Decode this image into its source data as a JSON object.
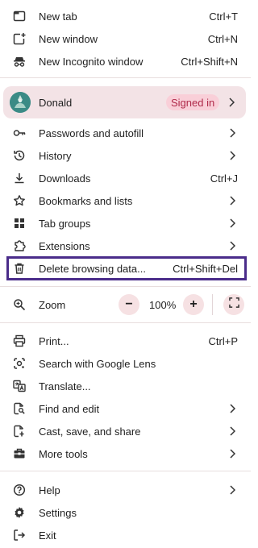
{
  "menu": {
    "new_tab": {
      "label": "New tab",
      "shortcut": "Ctrl+T",
      "icon": "new-tab-icon"
    },
    "new_window": {
      "label": "New window",
      "shortcut": "Ctrl+N",
      "icon": "new-window-icon"
    },
    "new_incognito": {
      "label": "New Incognito window",
      "shortcut": "Ctrl+Shift+N",
      "icon": "incognito-icon"
    },
    "profile": {
      "name": "Donald",
      "status": "Signed in",
      "accent": "#b02a4a",
      "bg": "#f3e3e6"
    },
    "passwords": {
      "label": "Passwords and autofill",
      "icon": "key-icon"
    },
    "history": {
      "label": "History",
      "icon": "history-icon"
    },
    "downloads": {
      "label": "Downloads",
      "shortcut": "Ctrl+J",
      "icon": "download-icon"
    },
    "bookmarks": {
      "label": "Bookmarks and lists",
      "icon": "star-icon"
    },
    "tab_groups": {
      "label": "Tab groups",
      "icon": "tab-groups-icon"
    },
    "extensions": {
      "label": "Extensions",
      "icon": "puzzle-icon"
    },
    "delete_data": {
      "label": "Delete browsing data...",
      "shortcut": "Ctrl+Shift+Del",
      "icon": "trash-icon",
      "highlight_color": "#4a2c8a"
    },
    "zoom": {
      "label": "Zoom",
      "minus": "−",
      "value": "100%",
      "plus": "+",
      "icon": "zoom-icon"
    },
    "print": {
      "label": "Print...",
      "shortcut": "Ctrl+P",
      "icon": "print-icon"
    },
    "google_lens": {
      "label": "Search with Google Lens",
      "icon": "lens-icon"
    },
    "translate": {
      "label": "Translate...",
      "icon": "translate-icon"
    },
    "find_edit": {
      "label": "Find and edit",
      "icon": "find-icon"
    },
    "cast_save_share": {
      "label": "Cast, save, and share",
      "icon": "cast-icon"
    },
    "more_tools": {
      "label": "More tools",
      "icon": "toolbox-icon"
    },
    "help": {
      "label": "Help",
      "icon": "help-icon"
    },
    "settings": {
      "label": "Settings",
      "icon": "gear-icon"
    },
    "exit": {
      "label": "Exit",
      "icon": "exit-icon"
    }
  }
}
